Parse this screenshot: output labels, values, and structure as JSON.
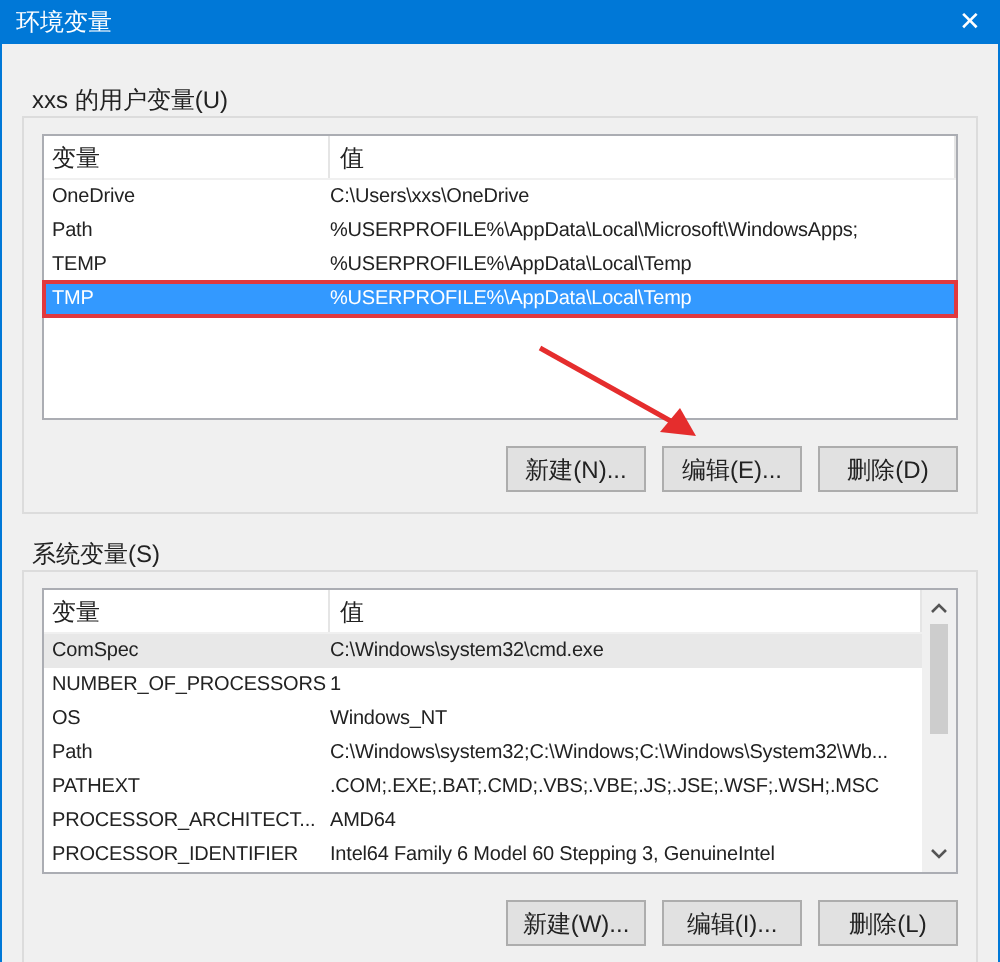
{
  "window": {
    "title": "环境变量",
    "close": "✕"
  },
  "user_variables": {
    "label": "xxs 的用户变量(U)",
    "focused": true,
    "columns": [
      "变量",
      "值"
    ],
    "rows": [
      {
        "name": "OneDrive",
        "value": "C:\\Users\\xxs\\OneDrive",
        "selected": false,
        "highlighted": false
      },
      {
        "name": "Path",
        "value": "%USERPROFILE%\\AppData\\Local\\Microsoft\\WindowsApps;",
        "selected": false,
        "highlighted": false
      },
      {
        "name": "TEMP",
        "value": "%USERPROFILE%\\AppData\\Local\\Temp",
        "selected": false,
        "highlighted": false
      },
      {
        "name": "TMP",
        "value": "%USERPROFILE%\\AppData\\Local\\Temp",
        "selected": true,
        "highlighted": true
      }
    ],
    "buttons": [
      "新建(N)...",
      "编辑(E)...",
      "删除(D)"
    ]
  },
  "system_variables": {
    "label": "系统变量(S)",
    "focused": false,
    "columns": [
      "变量",
      "值"
    ],
    "rows": [
      {
        "name": "ComSpec",
        "value": "C:\\Windows\\system32\\cmd.exe",
        "selected": true,
        "highlighted": false
      },
      {
        "name": "NUMBER_OF_PROCESSORS",
        "value": "1",
        "selected": false,
        "highlighted": false
      },
      {
        "name": "OS",
        "value": "Windows_NT",
        "selected": false,
        "highlighted": false
      },
      {
        "name": "Path",
        "value": "C:\\Windows\\system32;C:\\Windows;C:\\Windows\\System32\\Wb...",
        "selected": false,
        "highlighted": false
      },
      {
        "name": "PATHEXT",
        "value": ".COM;.EXE;.BAT;.CMD;.VBS;.VBE;.JS;.JSE;.WSF;.WSH;.MSC",
        "selected": false,
        "highlighted": false
      },
      {
        "name": "PROCESSOR_ARCHITECT...",
        "value": "AMD64",
        "selected": false,
        "highlighted": false
      },
      {
        "name": "PROCESSOR_IDENTIFIER",
        "value": "Intel64 Family 6 Model 60 Stepping 3, GenuineIntel",
        "selected": false,
        "highlighted": false
      }
    ],
    "buttons": [
      "新建(W)...",
      "编辑(I)...",
      "删除(L)"
    ]
  }
}
